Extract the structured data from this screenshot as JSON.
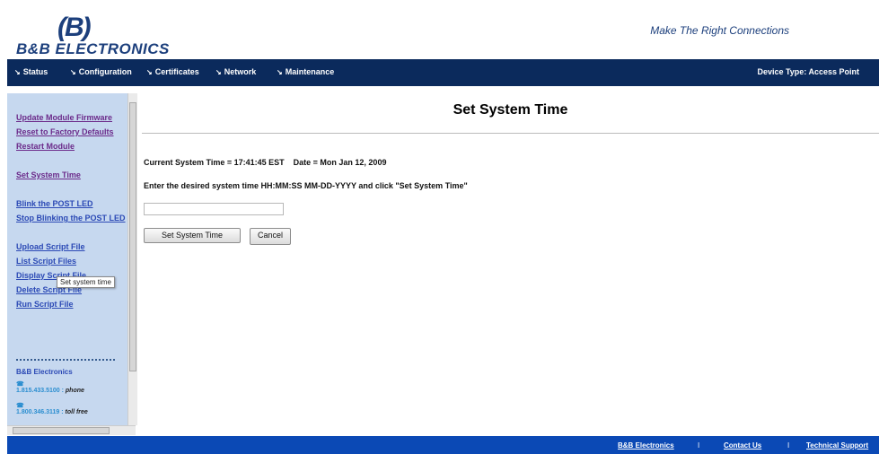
{
  "header": {
    "logo_mark": "(B)",
    "logo_text": "B&B ELECTRONICS",
    "tagline": "Make The Right Connections"
  },
  "nav": {
    "items": [
      {
        "label": "Status"
      },
      {
        "label": "Configuration"
      },
      {
        "label": "Certificates"
      },
      {
        "label": "Network"
      },
      {
        "label": "Maintenance"
      }
    ],
    "device_type": "Device Type: Access Point"
  },
  "sidebar": {
    "links": [
      {
        "label": "Update Module Firmware"
      },
      {
        "label": "Reset to Factory Defaults"
      },
      {
        "label": "Restart Module"
      },
      {
        "label": "Set System Time"
      },
      {
        "label": "Blink the POST LED"
      },
      {
        "label": "Stop Blinking the POST LED"
      },
      {
        "label": "Upload Script File"
      },
      {
        "label": "List Script Files"
      },
      {
        "label": "Display Script File"
      },
      {
        "label": "Delete Script File"
      },
      {
        "label": "Run Script File"
      }
    ],
    "tooltip": "Set system time",
    "contact": {
      "title": "B&B Electronics",
      "phone_number": "1.815.433.5100",
      "phone_label": "phone",
      "tollfree_number": "1.800.346.3119",
      "tollfree_label": "toll free"
    }
  },
  "main": {
    "title": "Set System Time",
    "current_time": "Current System Time = 17:41:45 EST    Date = Mon Jan 12, 2009",
    "instruction": "Enter the desired system time HH:MM:SS MM-DD-YYYY and click \"Set System Time\"",
    "input_value": "",
    "set_button": "Set System Time",
    "cancel_button": "Cancel"
  },
  "footer": {
    "links": [
      {
        "label": "B&B Electronics"
      },
      {
        "label": "Contact Us"
      },
      {
        "label": "Technical Support"
      }
    ],
    "separator": "I"
  },
  "colors": {
    "nav_bg": "#0b2a5c",
    "footer_bg": "#0b49b5",
    "sidebar_bg": "#c6d8ef",
    "brand": "#1c3f7c"
  }
}
